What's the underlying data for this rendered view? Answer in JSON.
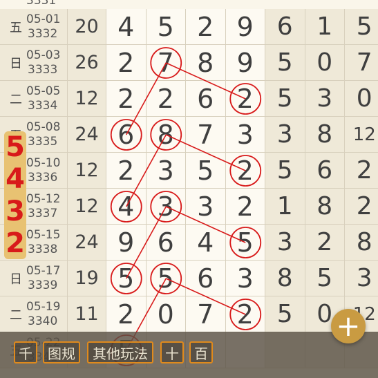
{
  "top_partial": {
    "issue": "3331"
  },
  "rows": [
    {
      "weekday": "五",
      "date": "05-01",
      "issue": "3332",
      "sum": "20",
      "digits": [
        "4",
        "5",
        "2",
        "9"
      ],
      "extra": [
        "6",
        "1",
        "5"
      ]
    },
    {
      "weekday": "日",
      "date": "05-03",
      "issue": "3333",
      "sum": "26",
      "digits": [
        "2",
        "7",
        "8",
        "9"
      ],
      "extra": [
        "5",
        "0",
        "7"
      ]
    },
    {
      "weekday": "二",
      "date": "05-05",
      "issue": "3334",
      "sum": "12",
      "digits": [
        "2",
        "2",
        "6",
        "2"
      ],
      "extra": [
        "5",
        "3",
        "0"
      ]
    },
    {
      "weekday": "五",
      "date": "05-08",
      "issue": "3335",
      "sum": "24",
      "digits": [
        "6",
        "8",
        "7",
        "3"
      ],
      "extra": [
        "3",
        "8",
        "12"
      ]
    },
    {
      "weekday": "",
      "date": "05-10",
      "issue": "3336",
      "sum": "12",
      "digits": [
        "2",
        "3",
        "5",
        "2"
      ],
      "extra": [
        "5",
        "6",
        "2"
      ]
    },
    {
      "weekday": "",
      "date": "05-12",
      "issue": "3337",
      "sum": "12",
      "digits": [
        "4",
        "3",
        "3",
        "2"
      ],
      "extra": [
        "1",
        "8",
        "2"
      ]
    },
    {
      "weekday": "",
      "date": "05-15",
      "issue": "3338",
      "sum": "24",
      "digits": [
        "9",
        "6",
        "4",
        "5"
      ],
      "extra": [
        "3",
        "2",
        "8"
      ]
    },
    {
      "weekday": "日",
      "date": "05-17",
      "issue": "3339",
      "sum": "19",
      "digits": [
        "5",
        "5",
        "6",
        "3"
      ],
      "extra": [
        "8",
        "5",
        "3"
      ]
    },
    {
      "weekday": "二",
      "date": "05-19",
      "issue": "3340",
      "sum": "11",
      "digits": [
        "2",
        "0",
        "7",
        "2"
      ],
      "extra": [
        "5",
        "0",
        "12"
      ]
    },
    {
      "weekday": "五",
      "date": "05-22",
      "issue": "3341",
      "sum": "",
      "digits": [
        "5",
        "",
        "",
        ""
      ],
      "extra": [
        "",
        "",
        ""
      ]
    }
  ],
  "highlights": [
    [
      1,
      1
    ],
    [
      2,
      3
    ],
    [
      3,
      0
    ],
    [
      3,
      1
    ],
    [
      4,
      3
    ],
    [
      5,
      0
    ],
    [
      5,
      1
    ],
    [
      6,
      3
    ],
    [
      7,
      0
    ],
    [
      7,
      1
    ],
    [
      8,
      3
    ],
    [
      9,
      0
    ]
  ],
  "sidebar_digits": [
    "5",
    "4",
    "3",
    "2"
  ],
  "buttons": [
    "千",
    "图规",
    "其他玩法",
    "十",
    "百"
  ],
  "fab_label": "+",
  "colors": {
    "accent": "#e08a1c",
    "marker": "#d81a1a",
    "gold": "#e8c272"
  }
}
